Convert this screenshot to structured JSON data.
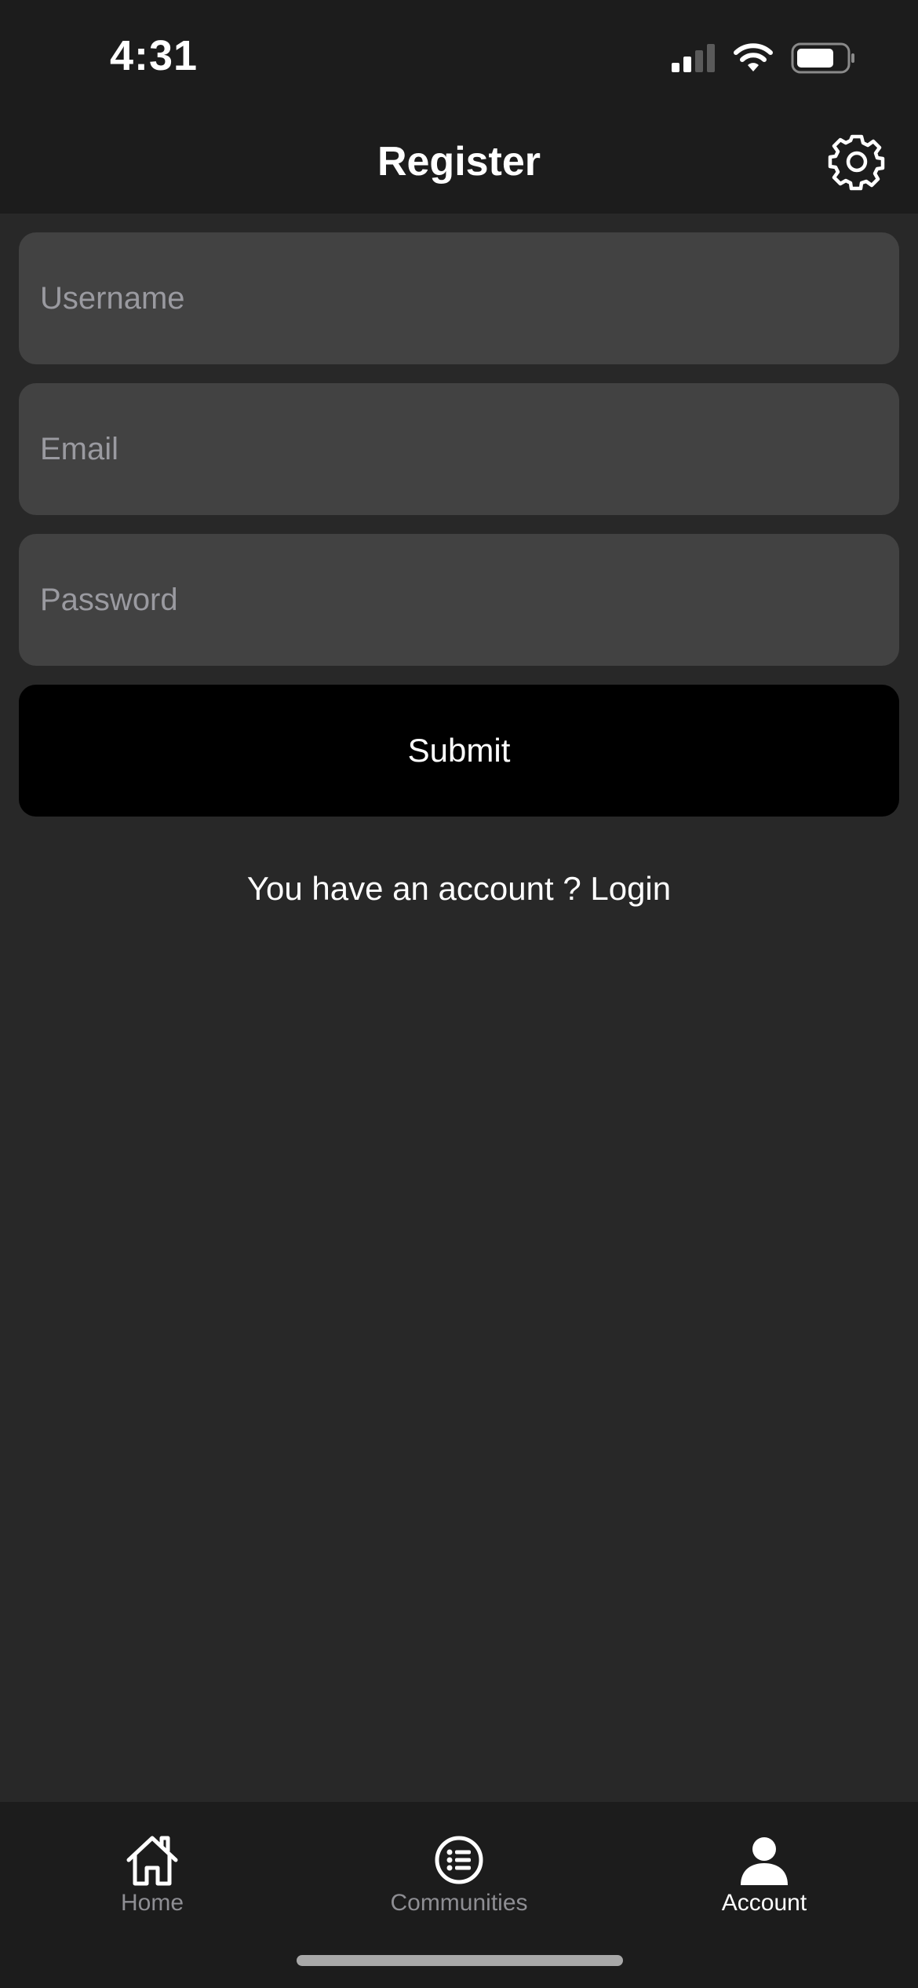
{
  "status_bar": {
    "time": "4:31"
  },
  "header": {
    "title": "Register"
  },
  "form": {
    "username_placeholder": "Username",
    "email_placeholder": "Email",
    "password_placeholder": "Password",
    "submit_label": "Submit"
  },
  "login_prompt": {
    "text": "You have an account ?",
    "link": "Login"
  },
  "tab_bar": {
    "tabs": [
      {
        "label": "Home",
        "icon": "home-icon",
        "active": false
      },
      {
        "label": "Communities",
        "icon": "list-icon",
        "active": false
      },
      {
        "label": "Account",
        "icon": "person-icon",
        "active": true
      }
    ]
  },
  "colors": {
    "background": "#282828",
    "bar_background": "#1c1c1c",
    "field_background": "#424242",
    "button_background": "#000000",
    "inactive_tab": "#8e8e93",
    "active_tab": "#ffffff"
  }
}
